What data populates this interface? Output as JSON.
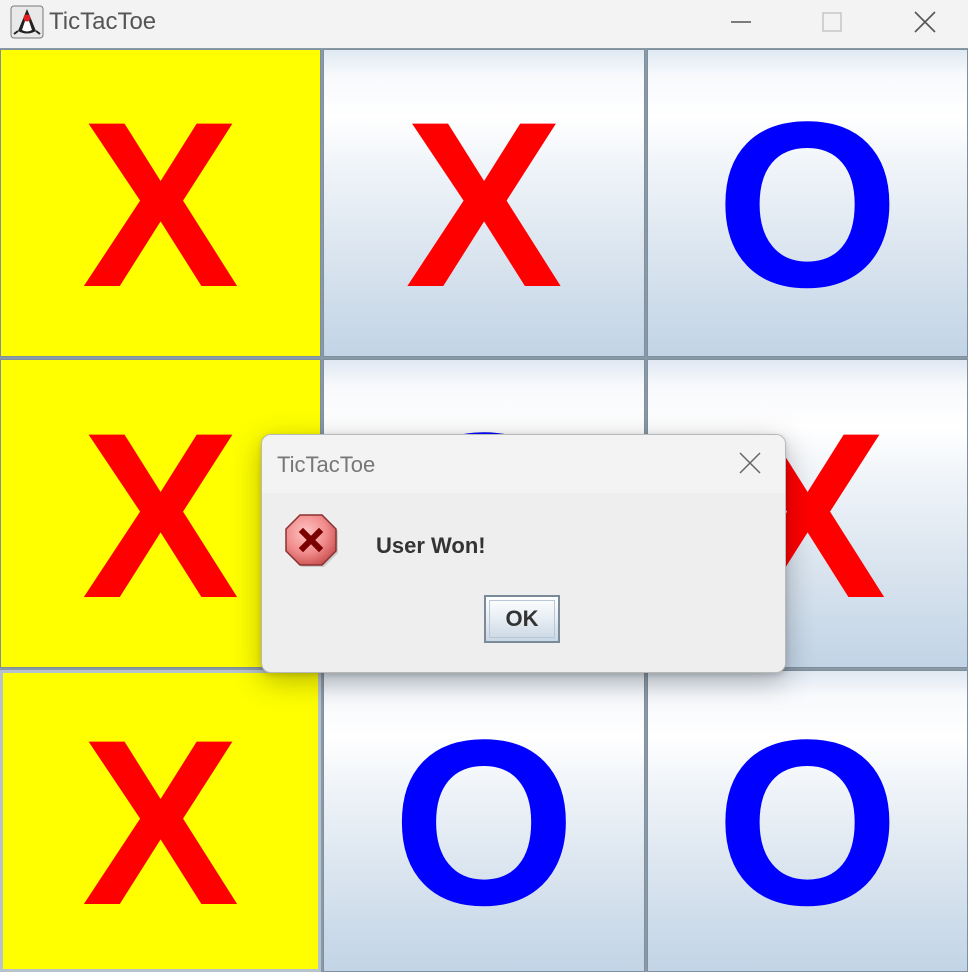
{
  "window": {
    "title": "TicTacToe",
    "icon": "java-duke-icon"
  },
  "board": {
    "cells": [
      {
        "mark": "X",
        "winning": true
      },
      {
        "mark": "X",
        "winning": false
      },
      {
        "mark": "O",
        "winning": false
      },
      {
        "mark": "X",
        "winning": true
      },
      {
        "mark": "O",
        "winning": false
      },
      {
        "mark": "X",
        "winning": false
      },
      {
        "mark": "X",
        "winning": true
      },
      {
        "mark": "O",
        "winning": false
      },
      {
        "mark": "O",
        "winning": false
      }
    ],
    "colors": {
      "x_mark": "#ff0000",
      "o_mark": "#0000ff",
      "win_highlight": "#ffff00"
    }
  },
  "dialog": {
    "title": "TicTacToe",
    "message": "User Won!",
    "icon": "error-icon",
    "ok_label": "OK"
  }
}
